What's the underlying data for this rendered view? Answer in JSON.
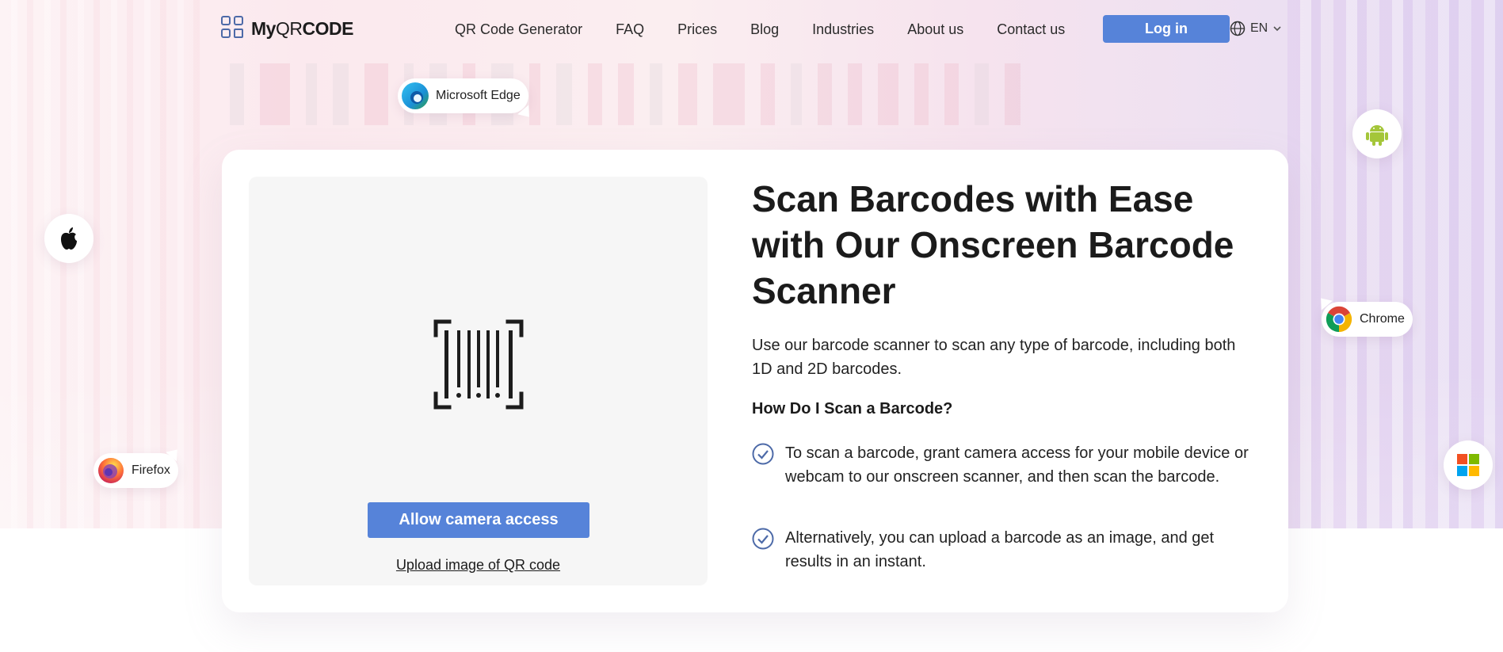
{
  "header": {
    "logo": {
      "part1": "My",
      "part2": "QR",
      "part3": "CODE"
    },
    "nav": [
      "QR Code Generator",
      "FAQ",
      "Prices",
      "Blog",
      "Industries",
      "About us",
      "Contact us"
    ],
    "login_label": "Log in",
    "language": "EN"
  },
  "badges": {
    "edge": "Microsoft Edge",
    "chrome": "Chrome",
    "firefox": "Firefox"
  },
  "scanner": {
    "allow_label": "Allow camera access",
    "upload_label": "Upload image of QR code"
  },
  "content": {
    "title": "Scan Barcodes with Ease with Our Onscreen Barcode Scanner",
    "intro": "Use our barcode scanner to scan any type of barcode, including both 1D and 2D barcodes.",
    "subtitle": "How Do I Scan a Barcode?",
    "steps": [
      "To scan a barcode, grant camera access for your mobile device or webcam to our onscreen scanner, and then scan the barcode.",
      "Alternatively, you can upload a barcode as an image, and get results in an instant."
    ]
  },
  "colors": {
    "accent": "#5683d9",
    "check": "#4d6aa8",
    "text": "#1c1c1c"
  },
  "icons": [
    "qr-logo-icon",
    "globe-icon",
    "chevron-down-icon",
    "edge-icon",
    "android-icon",
    "apple-icon",
    "chrome-icon",
    "firefox-icon",
    "windows-icon",
    "barcode-scan-icon",
    "check-circle-icon"
  ]
}
